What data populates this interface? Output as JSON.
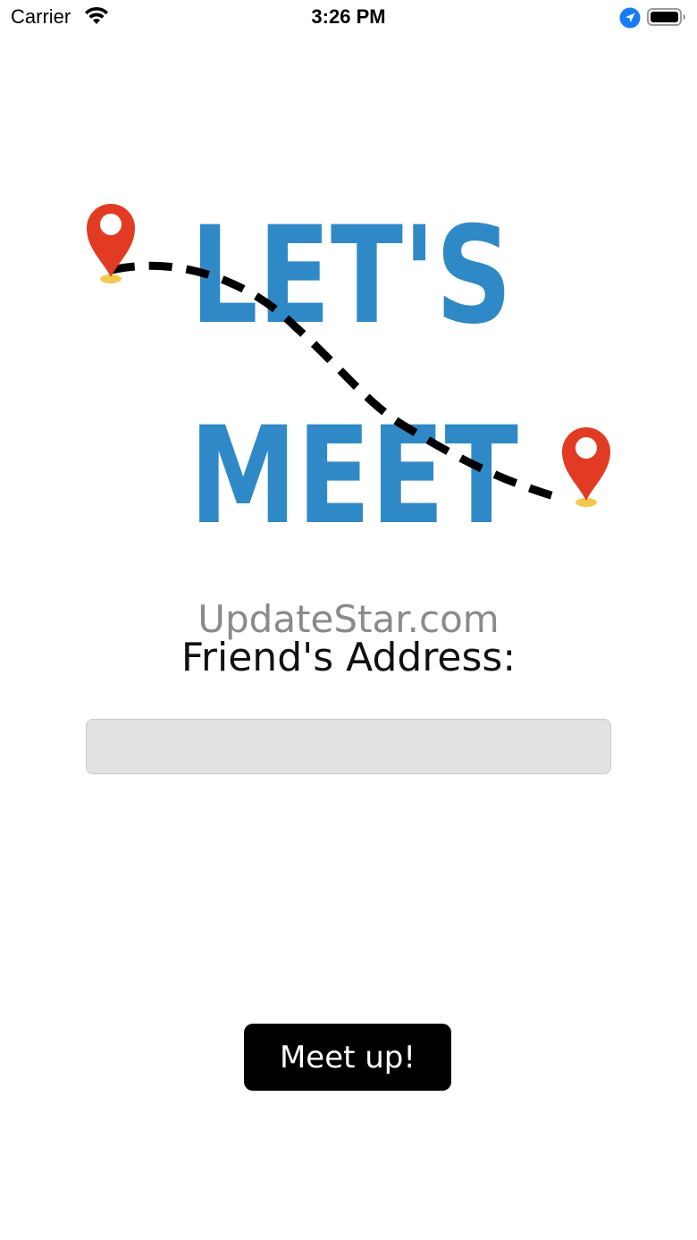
{
  "status_bar": {
    "carrier": "Carrier",
    "time": "3:26 PM",
    "icons": [
      "wifi-icon",
      "location-arrow-icon",
      "battery-icon"
    ]
  },
  "logo": {
    "line1": "LET'S",
    "line2": "MEET",
    "text_color": "#3089C7",
    "pin_color": "#E23B24",
    "pin_base_color": "#F2C94C",
    "path_color": "#000000"
  },
  "watermark": "UpdateStar.com",
  "form": {
    "address_label": "Friend's Address:",
    "address_value": "",
    "address_placeholder": ""
  },
  "actions": {
    "meet_up_label": "Meet up!"
  },
  "colors": {
    "background": "#FFFFFF",
    "input_background": "#E2E2E2",
    "button_background": "#000000",
    "button_text": "#FFFFFF"
  }
}
